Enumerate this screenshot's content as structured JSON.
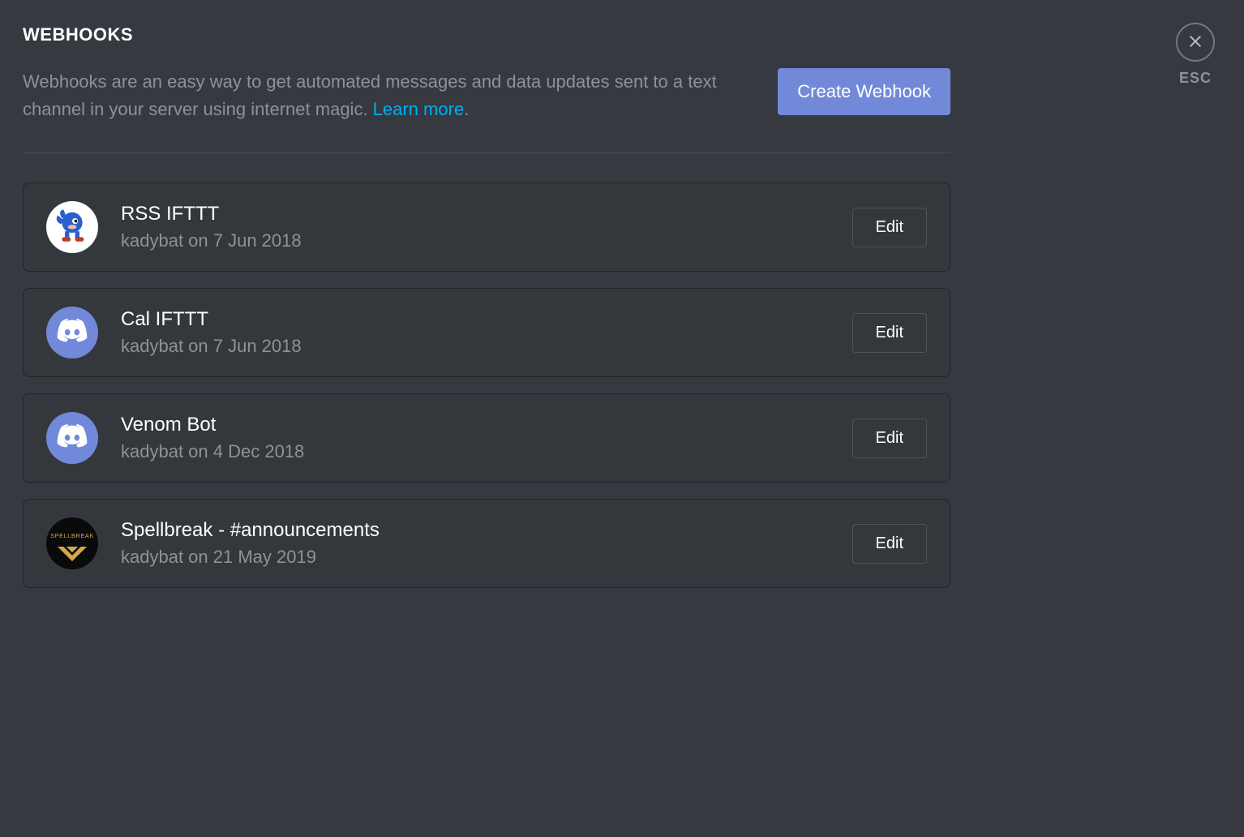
{
  "page": {
    "title": "WEBHOOKS",
    "description_prefix": "Webhooks are an easy way to get automated messages and data updates sent to a text channel in your server using internet magic. ",
    "learn_more": "Learn more",
    "description_suffix": "."
  },
  "actions": {
    "create_label": "Create Webhook",
    "edit_label": "Edit",
    "esc_label": "ESC"
  },
  "webhooks": [
    {
      "name": "RSS IFTTT",
      "meta": "kadybat on 7 Jun 2018",
      "avatar": "sonic"
    },
    {
      "name": "Cal IFTTT",
      "meta": "kadybat on 7 Jun 2018",
      "avatar": "discord"
    },
    {
      "name": "Venom Bot",
      "meta": "kadybat on 4 Dec 2018",
      "avatar": "discord"
    },
    {
      "name": "Spellbreak - #announcements",
      "meta": "kadybat on 21 May 2019",
      "avatar": "spellbreak"
    }
  ],
  "icons": {
    "spellbreak_text": "SPELLBREAK"
  }
}
